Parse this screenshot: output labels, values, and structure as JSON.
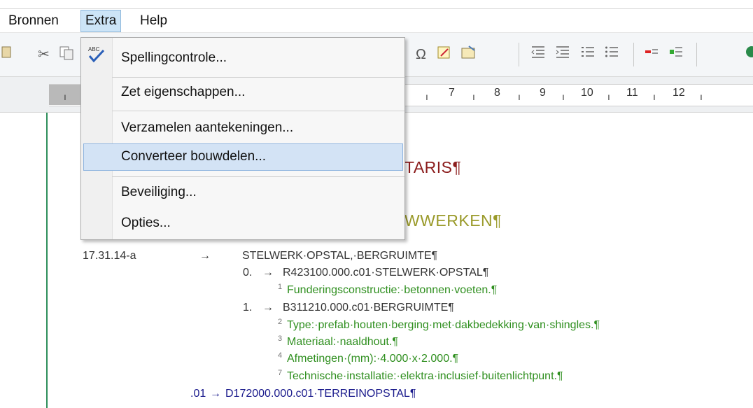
{
  "menubar": {
    "items": [
      "Bronnen",
      "Extra",
      "Help"
    ]
  },
  "dropdown": {
    "items": [
      "Spellingcontrole...",
      "Zet eigenschappen...",
      "Verzamelen aantekeningen...",
      "Converteer bouwdelen...",
      "Beveiliging...",
      "Opties..."
    ],
    "highlighted": "Converteer bouwdelen...",
    "spell_icon_text": "ABC"
  },
  "toolbar": {
    "omega_symbol": "Ω"
  },
  "ruler": {
    "numbers": [
      "7",
      "8",
      "9",
      "10",
      "11",
      "12"
    ]
  },
  "document": {
    "heading1": "TARIS¶",
    "heading2": "WWERKEN¶",
    "code": "17.31.14-a",
    "title": "STELWERK·OPSTAL,·BERGRUIMTE¶",
    "items": [
      {
        "num": "0.",
        "text": "R423100.000.c01·STELWERK·OPSTAL¶"
      },
      {
        "sup": "1",
        "text": "Funderingsconstructie:·betonnen·voeten.¶"
      },
      {
        "num": "1.",
        "text": "B311210.000.c01·BERGRUIMTE¶"
      },
      {
        "sup": "2",
        "text": "Type:·prefab·houten·berging·met·dakbedekking·van·shingles.¶"
      },
      {
        "sup": "3",
        "text": "Materiaal:·naaldhout.¶"
      },
      {
        "sup": "4",
        "text": "Afmetingen·(mm):·4.000·x·2.000.¶"
      },
      {
        "sup": "7",
        "text": "Technische·installatie:·elektra·inclusief·buitenlichtpunt.¶"
      }
    ],
    "last_num": ".01",
    "last_text": "D172000.000.c01·TERREINOPSTAL¶",
    "arrow": "→"
  }
}
